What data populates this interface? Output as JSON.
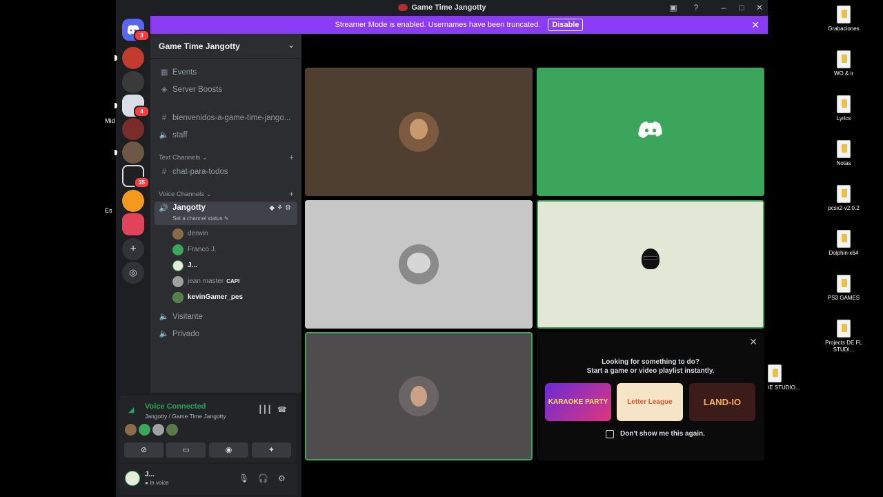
{
  "window": {
    "title": "Game Time Jangotty"
  },
  "banner": {
    "text": "Streamer Mode is enabled. Usernames have been truncated.",
    "disable_label": "Disable"
  },
  "desktop": {
    "left_fragments": [
      "Mid",
      "Es"
    ],
    "icons": [
      "Grabaciones",
      "WO & ir",
      "Lyrics",
      "Notas",
      "pcsx2-v2.0.2",
      "Dolphin-x64",
      "PS3 GAMES",
      "Projects DE FL STUDI...",
      "ojects DE STUDIO..."
    ]
  },
  "guilds": {
    "badges": [
      "3",
      "4",
      "35"
    ]
  },
  "server": {
    "name": "Game Time Jangotty",
    "events": "Events",
    "boosts": "Server Boosts",
    "channels_top": [
      "bienvenidos-a-game-time-jango...",
      "staff"
    ],
    "text_category": "Text Channels",
    "text_channels": [
      "chat-para-todos"
    ],
    "voice_category": "Voice Channels",
    "active_voice": "Jangotty",
    "active_status": "Set a channel status",
    "voice_users": [
      {
        "name": "derwin",
        "tag": ""
      },
      {
        "name": "Franco J.",
        "tag": ""
      },
      {
        "name": "J...",
        "tag": ""
      },
      {
        "name": "jean master",
        "tag": "CAPI"
      },
      {
        "name": "kevinGamer_pes",
        "tag": ""
      }
    ],
    "other_voice": [
      "Visitante",
      "Privado"
    ]
  },
  "voice_panel": {
    "status": "Voice Connected",
    "location": "Jangotty / Game Time Jangotty"
  },
  "user": {
    "name": "J...",
    "status": "In voice"
  },
  "activity": {
    "line1": "Looking for something to do?",
    "line2": "Start a game or video playlist instantly.",
    "games": [
      "KARAOKE PARTY",
      "Letter League",
      "LAND-IO"
    ],
    "checkbox": "Don't show me this again."
  },
  "colors": {
    "accent": "#5865f2",
    "banner": "#8c3bf4",
    "green": "#23a559",
    "tile_brown": "#4e3f31",
    "tile_green": "#3ba55c"
  }
}
